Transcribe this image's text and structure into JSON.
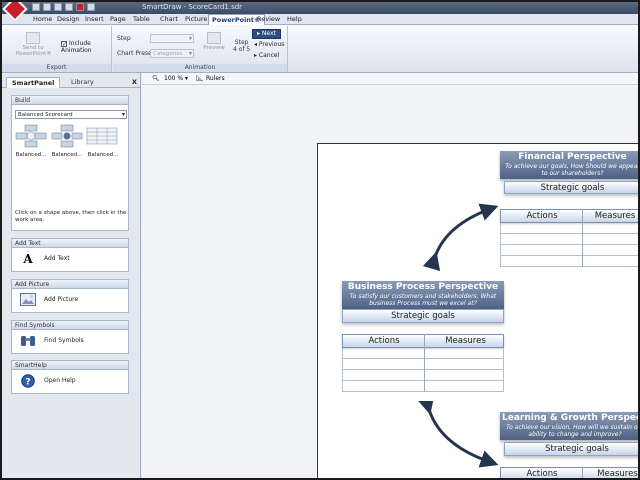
{
  "titlebar": {
    "title": "SmartDraw - ScoreCard1.sdr"
  },
  "menu_tabs": [
    "Home",
    "Design",
    "Insert",
    "Page",
    "Table",
    "Chart",
    "Picture",
    "PowerPoint®",
    "Review",
    "Help"
  ],
  "active_tab": "PowerPoint®",
  "ribbon": {
    "export": {
      "label": "Export",
      "send_button": "Send to PowerPoint®",
      "include_animation": "Include Animation",
      "include_animation_checked": true
    },
    "animation": {
      "label": "Animation",
      "step_label": "Step",
      "chart_preset_label": "Chart Preset",
      "chart_preset_value": "Categories",
      "preview_button": "Preview",
      "step_counter_line1": "Step",
      "step_counter_line2": "4 of 5",
      "next_button": "Next",
      "previous_button": "Previous",
      "cancel_button": "Cancel"
    }
  },
  "panel": {
    "tabs": [
      "SmartPanel",
      "Library"
    ],
    "active_tab": "SmartPanel",
    "close": "x",
    "build": {
      "header": "Build",
      "dropdown_value": "Balanced Scorecard",
      "shapes": [
        "Balanced...",
        "Balanced...",
        "Balanced..."
      ],
      "hint": "Click on a shape above, then click in the work area."
    },
    "add_text": {
      "header": "Add Text",
      "label": "Add Text"
    },
    "add_picture": {
      "header": "Add Picture",
      "label": "Add Picture"
    },
    "find_symbols": {
      "header": "Find Symbols",
      "label": "Find Symbols"
    },
    "smarthelp": {
      "header": "SmartHelp",
      "label": "Open Help"
    }
  },
  "workbar": {
    "zoom": "100 %",
    "rulers": "Rulers"
  },
  "cards": {
    "financial": {
      "title": "Financial Perspective",
      "subtitle": "To achieve our goals, How Should we appear to our shareholders?",
      "goals": "Strategic goals",
      "col1": "Actions",
      "col2": "Measures"
    },
    "business": {
      "title": "Business Process Perspective",
      "subtitle": "To satisfy our customers and stakeholders, What business Process must we excel at?",
      "goals": "Strategic goals",
      "col1": "Actions",
      "col2": "Measures"
    },
    "learning": {
      "title": "Learning & Growth Perspective",
      "subtitle": "To achieve our vision, How will we sustain our ability to change and improve?",
      "goals": "Strategic goals",
      "col1": "Actions",
      "col2": "Measures"
    }
  },
  "colors": {
    "accent": "#2f4d7e",
    "card_header": "#4e6287",
    "titlebar": "#3c4b63",
    "logo": "#c8202a"
  }
}
